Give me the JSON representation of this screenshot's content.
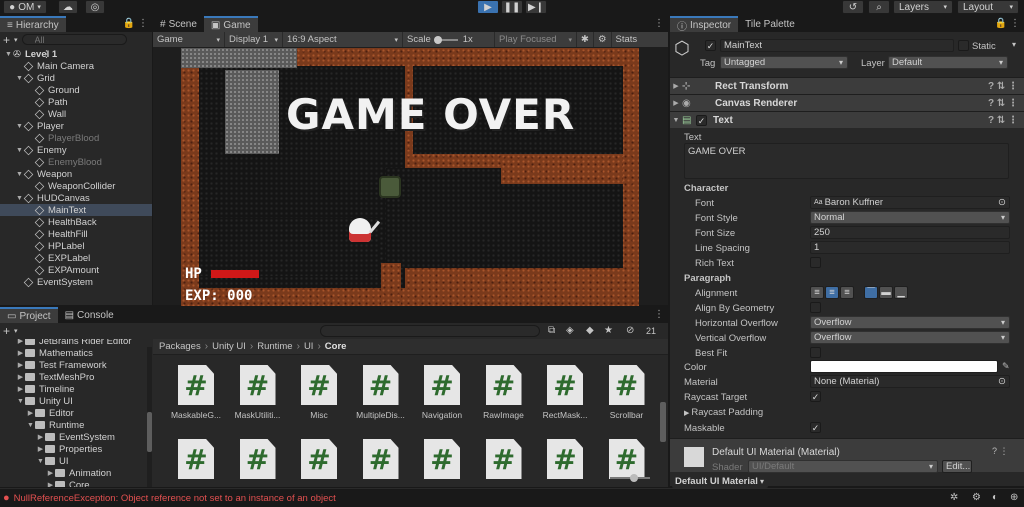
{
  "toolbar": {
    "account": "OM",
    "layers": "Layers",
    "layout": "Layout"
  },
  "hierarchy": {
    "tab": "Hierarchy",
    "search_placeholder": "All",
    "items": [
      {
        "label": "Level 1",
        "depth": 0,
        "type": "scene",
        "expanded": true
      },
      {
        "label": "Main Camera",
        "depth": 1
      },
      {
        "label": "Grid",
        "depth": 1,
        "expanded": true
      },
      {
        "label": "Ground",
        "depth": 2
      },
      {
        "label": "Path",
        "depth": 2
      },
      {
        "label": "Wall",
        "depth": 2
      },
      {
        "label": "Player",
        "depth": 1,
        "expanded": true
      },
      {
        "label": "PlayerBlood",
        "depth": 2,
        "dim": true
      },
      {
        "label": "Enemy",
        "depth": 1,
        "expanded": true
      },
      {
        "label": "EnemyBlood",
        "depth": 2,
        "dim": true
      },
      {
        "label": "Weapon",
        "depth": 1,
        "expanded": true
      },
      {
        "label": "WeaponCollider",
        "depth": 2
      },
      {
        "label": "HUDCanvas",
        "depth": 1,
        "expanded": true
      },
      {
        "label": "MainText",
        "depth": 2,
        "selected": true
      },
      {
        "label": "HealthBack",
        "depth": 2
      },
      {
        "label": "HealthFill",
        "depth": 2
      },
      {
        "label": "HPLabel",
        "depth": 2
      },
      {
        "label": "EXPLabel",
        "depth": 2
      },
      {
        "label": "EXPAmount",
        "depth": 2
      },
      {
        "label": "EventSystem",
        "depth": 1
      }
    ]
  },
  "game": {
    "tabs": [
      "Scene",
      "Game"
    ],
    "active_tab": "Game",
    "bar": {
      "mode": "Game",
      "display": "Display 1",
      "aspect": "16:9 Aspect",
      "scale_label": "Scale",
      "scale_value": "1x",
      "play_focused": "Play Focused",
      "stats": "Stats"
    },
    "gameover": "GAME OVER",
    "hp_label": "HP",
    "exp_label": "EXP: 000",
    "health_fill": 1.0
  },
  "inspector": {
    "tabs": [
      "Inspector",
      "Tile Palette"
    ],
    "object_name": "MainText",
    "static_label": "Static",
    "tag_label": "Tag",
    "tag_value": "Untagged",
    "layer_label": "Layer",
    "layer_value": "Default",
    "components": [
      "Rect Transform",
      "Canvas Renderer",
      "Text"
    ],
    "text_label": "Text",
    "text_value": "GAME OVER",
    "character": "Character",
    "font_label": "Font",
    "font_value": "Baron Kuffner",
    "font_style_label": "Font Style",
    "font_style_value": "Normal",
    "font_size_label": "Font Size",
    "font_size_value": "250",
    "line_spacing_label": "Line Spacing",
    "line_spacing_value": "1",
    "rich_text_label": "Rich Text",
    "paragraph": "Paragraph",
    "alignment_label": "Alignment",
    "align_geo_label": "Align By Geometry",
    "hoverflow_label": "Horizontal Overflow",
    "hoverflow_value": "Overflow",
    "voverflow_label": "Vertical Overflow",
    "voverflow_value": "Overflow",
    "bestfit_label": "Best Fit",
    "color_label": "Color",
    "color_value": "#ffffff",
    "material_label": "Material",
    "material_value": "None (Material)",
    "raycast_label": "Raycast Target",
    "raycast_padding_label": "Raycast Padding",
    "maskable_label": "Maskable",
    "material_section": "Default UI Material (Material)",
    "shader_label": "Shader",
    "shader_value": "UI/Default",
    "edit_label": "Edit...",
    "footer_label": "Default UI Material"
  },
  "project": {
    "tabs": [
      "Project",
      "Console"
    ],
    "count": "21",
    "breadcrumb": [
      "Packages",
      "Unity UI",
      "Runtime",
      "UI",
      "Core"
    ],
    "tree": [
      {
        "label": "JetBrains Rider Editor",
        "depth": 1,
        "partial": true
      },
      {
        "label": "Mathematics",
        "depth": 1
      },
      {
        "label": "Test Framework",
        "depth": 1
      },
      {
        "label": "TextMeshPro",
        "depth": 1
      },
      {
        "label": "Timeline",
        "depth": 1
      },
      {
        "label": "Unity UI",
        "depth": 1,
        "expanded": true
      },
      {
        "label": "Editor",
        "depth": 2
      },
      {
        "label": "Runtime",
        "depth": 2,
        "expanded": true
      },
      {
        "label": "EventSystem",
        "depth": 3
      },
      {
        "label": "Properties",
        "depth": 3
      },
      {
        "label": "UI",
        "depth": 3,
        "expanded": true
      },
      {
        "label": "Animation",
        "depth": 4
      },
      {
        "label": "Core",
        "depth": 4
      }
    ],
    "assets": [
      "MaskableG...",
      "MaskUtiliti...",
      "Misc",
      "MultipleDis...",
      "Navigation",
      "RawImage",
      "RectMask...",
      "Scrollbar"
    ],
    "assets_row2_count": 8
  },
  "status": {
    "error": "NullReferenceException: Object reference not set to an instance of an object"
  },
  "colors": {
    "accent": "#3a79bb",
    "error": "#e25050",
    "selection": "#3f4a5a"
  }
}
